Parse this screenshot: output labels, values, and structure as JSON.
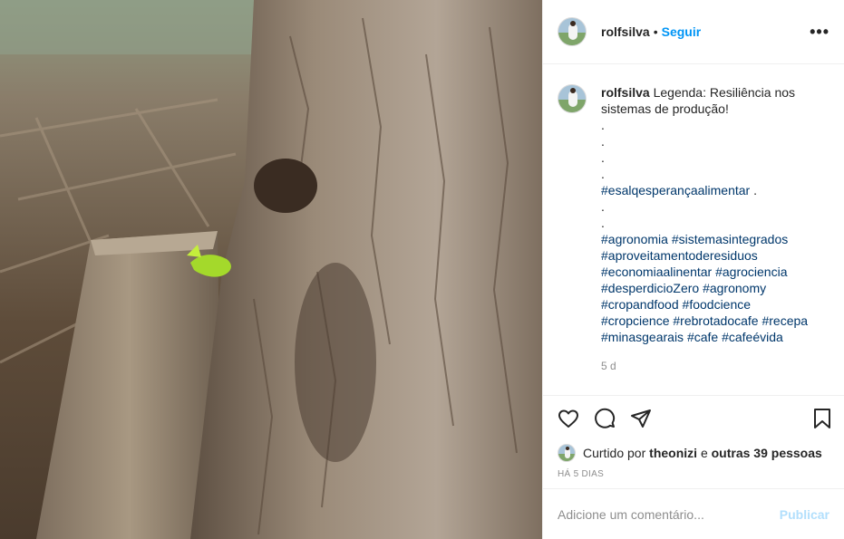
{
  "media": {
    "alt": ""
  },
  "header": {
    "username": "rolfsilva",
    "separator": "•",
    "follow_label": "Seguir",
    "more_icon": "more-dots-icon"
  },
  "caption": {
    "username": "rolfsilva",
    "text_lines": [
      "Legenda: Resiliência nos",
      "sistemas de produção!",
      ".",
      ".",
      ".",
      "."
    ],
    "tag_line1": "#esalqesperançaalimentar",
    "tag_line1_suffix": " .",
    "dots2": [
      ".",
      "."
    ],
    "hashtags": [
      [
        "#agronomia",
        "#sistemasintegrados"
      ],
      [
        "#aproveitamentoderesiduos"
      ],
      [
        "#economiaalinentar",
        "#agrociencia"
      ],
      [
        "#desperdicioZero",
        "#agronomy"
      ],
      [
        "#cropandfood",
        "#foodcience"
      ],
      [
        "#cropcience",
        "#rebrotadocafe",
        "#recepa"
      ],
      [
        "#minasgearais",
        "#cafe",
        "#cafeévida"
      ]
    ],
    "time": "5 d"
  },
  "actions": {
    "like_icon": "heart-icon",
    "comment_icon": "comment-icon",
    "share_icon": "share-icon",
    "save_icon": "bookmark-icon"
  },
  "likes": {
    "prefix": "Curtido por",
    "user": "theonizi",
    "middle": "e",
    "others": "outras 39 pessoas"
  },
  "posted_ago": "HÁ 5 DIAS",
  "comment_box": {
    "placeholder": "Adicione um comentário...",
    "publish_label": "Publicar"
  },
  "colors": {
    "link": "#0095f6",
    "hashtag": "#00376b",
    "muted": "#8e8e8e",
    "publish_disabled": "#b2dffc"
  }
}
